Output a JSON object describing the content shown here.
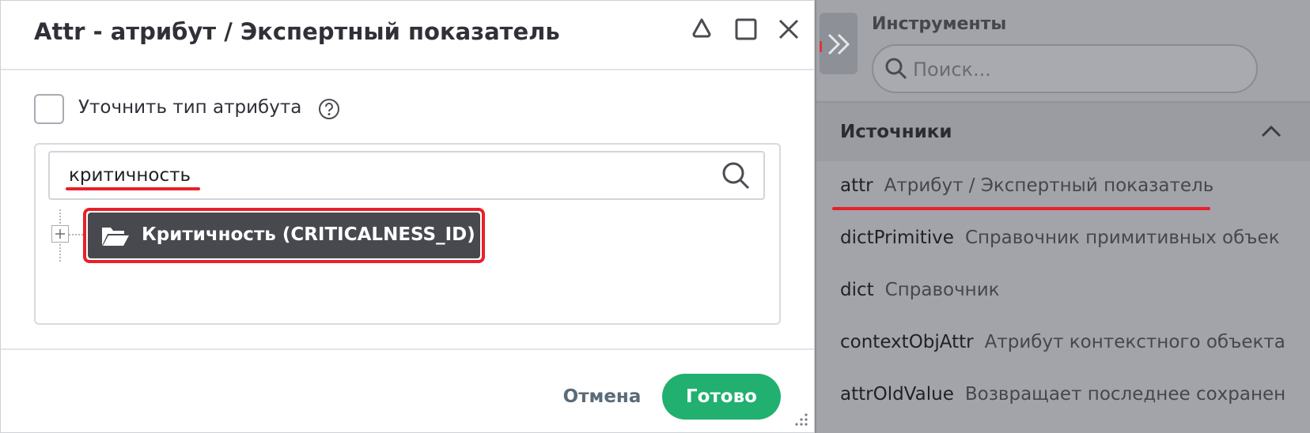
{
  "dialog": {
    "title": "Attr - атрибут / Экспертный показатель",
    "checkbox_label": "Уточнить тип атрибута",
    "search_value": "критичность",
    "tree_node_label": "Критичность (CRITICALNESS_ID)",
    "cancel_label": "Отмена",
    "done_label": "Готово"
  },
  "tools": {
    "title": "Инструменты",
    "search_placeholder": "Поиск...",
    "section_label": "Источники",
    "items": [
      {
        "key": "attr",
        "desc": "Атрибут / Экспертный показатель"
      },
      {
        "key": "dictPrimitive",
        "desc": "Справочник примитивных объек"
      },
      {
        "key": "dict",
        "desc": "Справочник"
      },
      {
        "key": "contextObjAttr",
        "desc": "Атрибут контекстного объекта"
      },
      {
        "key": "attrOldValue",
        "desc": "Возвращает последнее сохранен"
      }
    ]
  },
  "colors": {
    "accent_green": "#21b06f",
    "highlight_red": "#e8202a",
    "node_dark": "#47494f",
    "panel_grey": "#a2a4a9"
  }
}
